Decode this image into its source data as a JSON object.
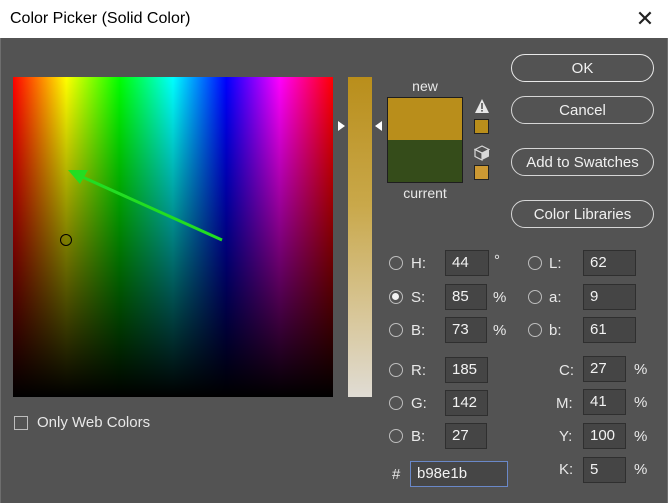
{
  "window": {
    "title": "Color Picker (Solid Color)",
    "close_glyph": "✕"
  },
  "preview": {
    "new_label": "new",
    "current_label": "current",
    "new_color": "#b98e1b",
    "current_color": "#354c1a"
  },
  "buttons": {
    "ok": "OK",
    "cancel": "Cancel",
    "add_swatches": "Add to Swatches",
    "libraries": "Color Libraries"
  },
  "hsb": {
    "h": {
      "label": "H:",
      "value": "44",
      "unit": "°"
    },
    "s": {
      "label": "S:",
      "value": "85",
      "unit": "%"
    },
    "b": {
      "label": "B:",
      "value": "73",
      "unit": "%"
    }
  },
  "rgb": {
    "r": {
      "label": "R:",
      "value": "185"
    },
    "g": {
      "label": "G:",
      "value": "142"
    },
    "b": {
      "label": "B:",
      "value": "27"
    }
  },
  "lab": {
    "l": {
      "label": "L:",
      "value": "62"
    },
    "a": {
      "label": "a:",
      "value": "9"
    },
    "b": {
      "label": "b:",
      "value": "61"
    }
  },
  "cmyk": {
    "c": {
      "label": "C:",
      "value": "27",
      "unit": "%"
    },
    "m": {
      "label": "M:",
      "value": "41",
      "unit": "%"
    },
    "y": {
      "label": "Y:",
      "value": "100",
      "unit": "%"
    },
    "k": {
      "label": "K:",
      "value": "5",
      "unit": "%"
    }
  },
  "hex": {
    "label": "#",
    "value": "b98e1b"
  },
  "web_colors": {
    "label": "Only Web Colors"
  },
  "colors": {
    "arrow": "#22dd22",
    "gamut_warning_swatch": "#b98e1b",
    "websafe_swatch": "#cc9933"
  }
}
